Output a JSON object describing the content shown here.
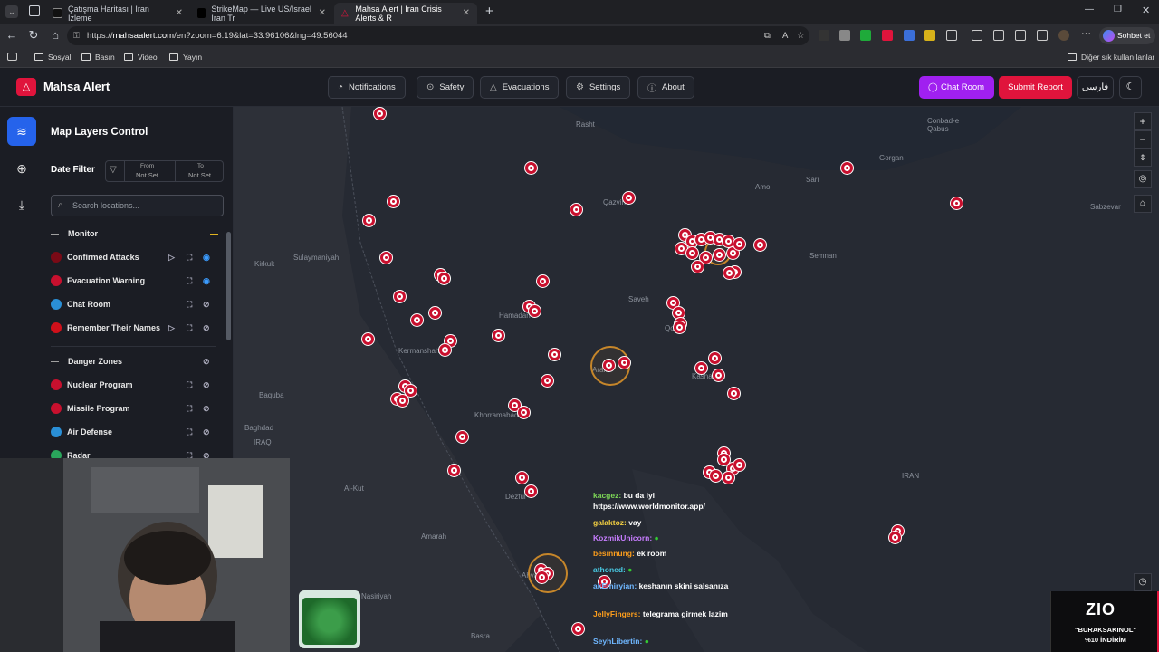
{
  "browser": {
    "tabs": [
      {
        "title": "Çatışma Haritası | İran İzleme"
      },
      {
        "title": "StrikeMap — Live US/Israel Iran Tr"
      },
      {
        "title": "Mahsa Alert | Iran Crisis Alerts & R"
      }
    ],
    "url_prefix": "https://",
    "url_host": "mahsaalert.com",
    "url_path": "/en?zoom=6.19&lat=33.96106&lng=49.56044",
    "profile_button": "Sohbet et",
    "bookmarks": [
      "Sosyal",
      "Basın",
      "Video",
      "Yayın"
    ],
    "other_bookmarks": "Diğer sık kullanılanlar"
  },
  "app": {
    "brand": "Mahsa Alert",
    "nav": [
      "Notifications",
      "Safety",
      "Evacuations",
      "Settings",
      "About"
    ],
    "chat_room_button": "Chat Room",
    "submit_report_button": "Submit Report",
    "language_button": "فارسی",
    "accent_purple": "#a020f0",
    "accent_red": "#e0143c"
  },
  "panel": {
    "title": "Map Layers Control",
    "date_filter_label": "Date Filter",
    "from_label": "From",
    "from_value": "Not Set",
    "to_label": "To",
    "to_value": "Not Set",
    "search_placeholder": "Search locations...",
    "monitor_header": "Monitor",
    "monitor_items": [
      {
        "label": "Confirmed Attacks",
        "color": "#7a0a16",
        "icon": "target-icon"
      },
      {
        "label": "Evacuation Warning",
        "color": "#c8102e",
        "icon": "running-icon"
      },
      {
        "label": "Chat Room",
        "color": "#2a8fd6",
        "icon": "telegram-icon"
      },
      {
        "label": "Remember Their Names",
        "color": "#d0101a",
        "icon": "heart-icon"
      }
    ],
    "danger_header": "Danger Zones",
    "danger_items": [
      {
        "label": "Nuclear Program",
        "color": "#c8102e",
        "icon": "radiation-icon"
      },
      {
        "label": "Missile Program",
        "color": "#c8102e",
        "icon": "missile-icon"
      },
      {
        "label": "Air Defense",
        "color": "#2a8fd6",
        "icon": "shield-icon"
      },
      {
        "label": "Radar",
        "color": "#2aa65c",
        "icon": "radar-icon"
      }
    ]
  },
  "map": {
    "cities": [
      "Rasht",
      "Conbad-e Qabus",
      "Gorgan",
      "Sari",
      "Amol",
      "Sabzevar",
      "Qazvin",
      "Semnan",
      "Saveh",
      "Hamadan",
      "Qom",
      "Kermanshah",
      "Arak",
      "Kashan",
      "Khorramabad",
      "Sulaymaniyah",
      "Kirkuk",
      "Baquba",
      "Baghdad",
      "IRAQ",
      "Al-Kut",
      "Dezful",
      "Amarah",
      "Ahvaz",
      "Nasiriyah",
      "Basra",
      "IRAN",
      "Maragheh",
      "Yazd"
    ]
  },
  "chat": [
    {
      "user": "kacgez:",
      "text": "bu da iyi https://www.worldmonitor.app/",
      "color": "#7ed957"
    },
    {
      "user": "galaktoz:",
      "text": "vay",
      "color": "#f5d142"
    },
    {
      "user": "KozmikUnicorn:",
      "text": "",
      "color": "#c77dff"
    },
    {
      "user": "besinnung:",
      "text": "ek room",
      "color": "#ff9f1c"
    },
    {
      "user": "athoned:",
      "text": "",
      "color": "#48cae4"
    },
    {
      "user": "akEmiryian:",
      "text": "keshanın skini salsanıza",
      "color": "#6fb7ff"
    },
    {
      "user": "JellyFingers:",
      "text": "telegrama girmek lazim",
      "color": "#ff9f1c"
    },
    {
      "user": "SeyhLibertin:",
      "text": "",
      "color": "#6fb7ff"
    }
  ],
  "promo": {
    "logo": "ZIO",
    "code": "\"BURAKSAKINOL\"",
    "discount": "%10 İNDİRİM"
  }
}
